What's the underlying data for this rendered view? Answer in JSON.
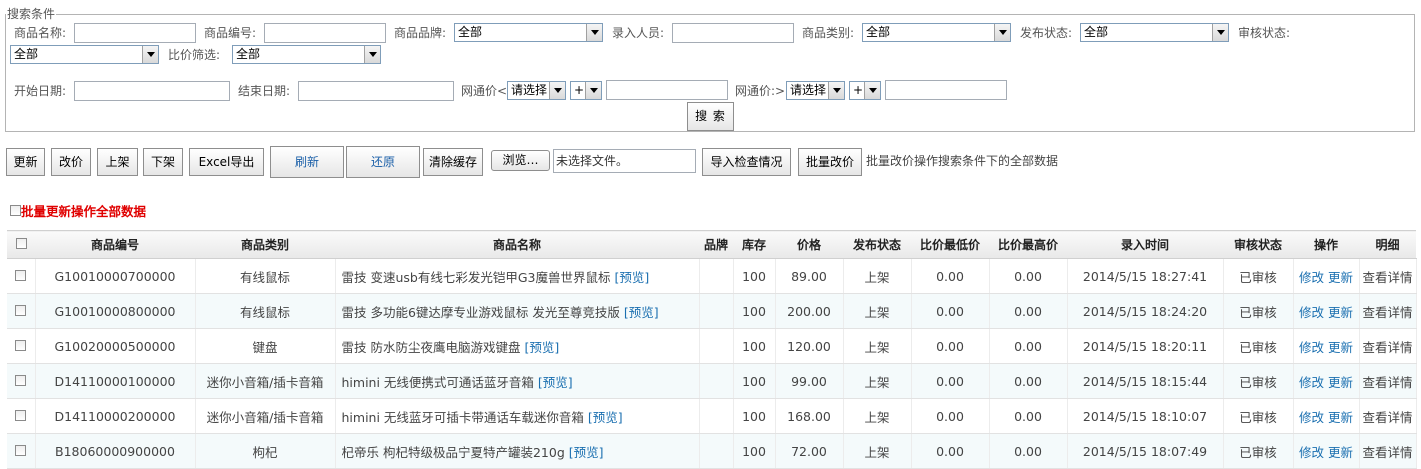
{
  "search": {
    "legend": "搜索条件",
    "labels": {
      "name": "商品名称:",
      "code": "商品编号:",
      "brand": "商品品牌:",
      "entry_user": "录入人员:",
      "category": "商品类别:",
      "publish_status": "发布状态:",
      "audit_status": "审核状态:",
      "compare_filter": "比价筛选:",
      "start_date": "开始日期:",
      "end_date": "结束日期:",
      "wtj_lt": "网通价<",
      "wtj_gt": "网通价:>"
    },
    "values": {
      "brand": "全部",
      "category": "全部",
      "publish_status": "全部",
      "audit_status": "全部",
      "compare_filter": "全部",
      "wtj_lt_select": "请选择",
      "wtj_lt_op": "+",
      "wtj_gt_select": "请选择",
      "wtj_gt_op": "+"
    },
    "search_button": "搜 索"
  },
  "toolbar": {
    "update": "更新",
    "change_price": "改价",
    "list_on": "上架",
    "list_off": "下架",
    "excel_export": "Excel导出",
    "refresh": "刷新",
    "restore": "还原",
    "clear_cache": "清除缓存",
    "browse": "浏览…",
    "no_file": "未选择文件。",
    "import_check": "导入检查情况",
    "batch_change_price": "批量改价",
    "batch_note": "批量改价操作搜索条件下的全部数据"
  },
  "batch_update_label": "批量更新操作全部数据",
  "table": {
    "headers": [
      "商品编号",
      "商品类别",
      "商品名称",
      "品牌",
      "库存",
      "价格",
      "发布状态",
      "比价最低价",
      "比价最高价",
      "录入时间",
      "审核状态",
      "操作",
      "明细"
    ],
    "preview_label": "[预览]",
    "edit_label": "修改",
    "update_label": "更新",
    "detail_label": "查看详情",
    "rows": [
      {
        "code": "G10010000700000",
        "category": "有线鼠标",
        "name": "雷技 变速usb有线七彩发光铠甲G3魔兽世界鼠标",
        "brand": "",
        "stock": "100",
        "price": "89.00",
        "status": "上架",
        "min": "0.00",
        "max": "0.00",
        "time": "2014/5/15 18:27:41",
        "audit": "已审核"
      },
      {
        "code": "G10010000800000",
        "category": "有线鼠标",
        "name": "雷技 多功能6键达摩专业游戏鼠标 发光至尊竞技版",
        "brand": "",
        "stock": "100",
        "price": "200.00",
        "status": "上架",
        "min": "0.00",
        "max": "0.00",
        "time": "2014/5/15 18:24:20",
        "audit": "已审核"
      },
      {
        "code": "G10020000500000",
        "category": "键盘",
        "name": "雷技 防水防尘夜鹰电脑游戏键盘",
        "brand": "",
        "stock": "100",
        "price": "120.00",
        "status": "上架",
        "min": "0.00",
        "max": "0.00",
        "time": "2014/5/15 18:20:11",
        "audit": "已审核"
      },
      {
        "code": "D14110000100000",
        "category": "迷你小音箱/插卡音箱",
        "name": "himini 无线便携式可通话蓝牙音箱",
        "brand": "",
        "stock": "100",
        "price": "99.00",
        "status": "上架",
        "min": "0.00",
        "max": "0.00",
        "time": "2014/5/15 18:15:44",
        "audit": "已审核"
      },
      {
        "code": "D14110000200000",
        "category": "迷你小音箱/插卡音箱",
        "name": "himini 无线蓝牙可插卡带通话车载迷你音箱",
        "brand": "",
        "stock": "100",
        "price": "168.00",
        "status": "上架",
        "min": "0.00",
        "max": "0.00",
        "time": "2014/5/15 18:10:07",
        "audit": "已审核"
      },
      {
        "code": "B18060000900000",
        "category": "枸杞",
        "name": "杞帝乐 枸杞特级极品宁夏特产罐装210g",
        "brand": "",
        "stock": "100",
        "price": "72.00",
        "status": "上架",
        "min": "0.00",
        "max": "0.00",
        "time": "2014/5/15 18:07:49",
        "audit": "已审核"
      }
    ]
  }
}
